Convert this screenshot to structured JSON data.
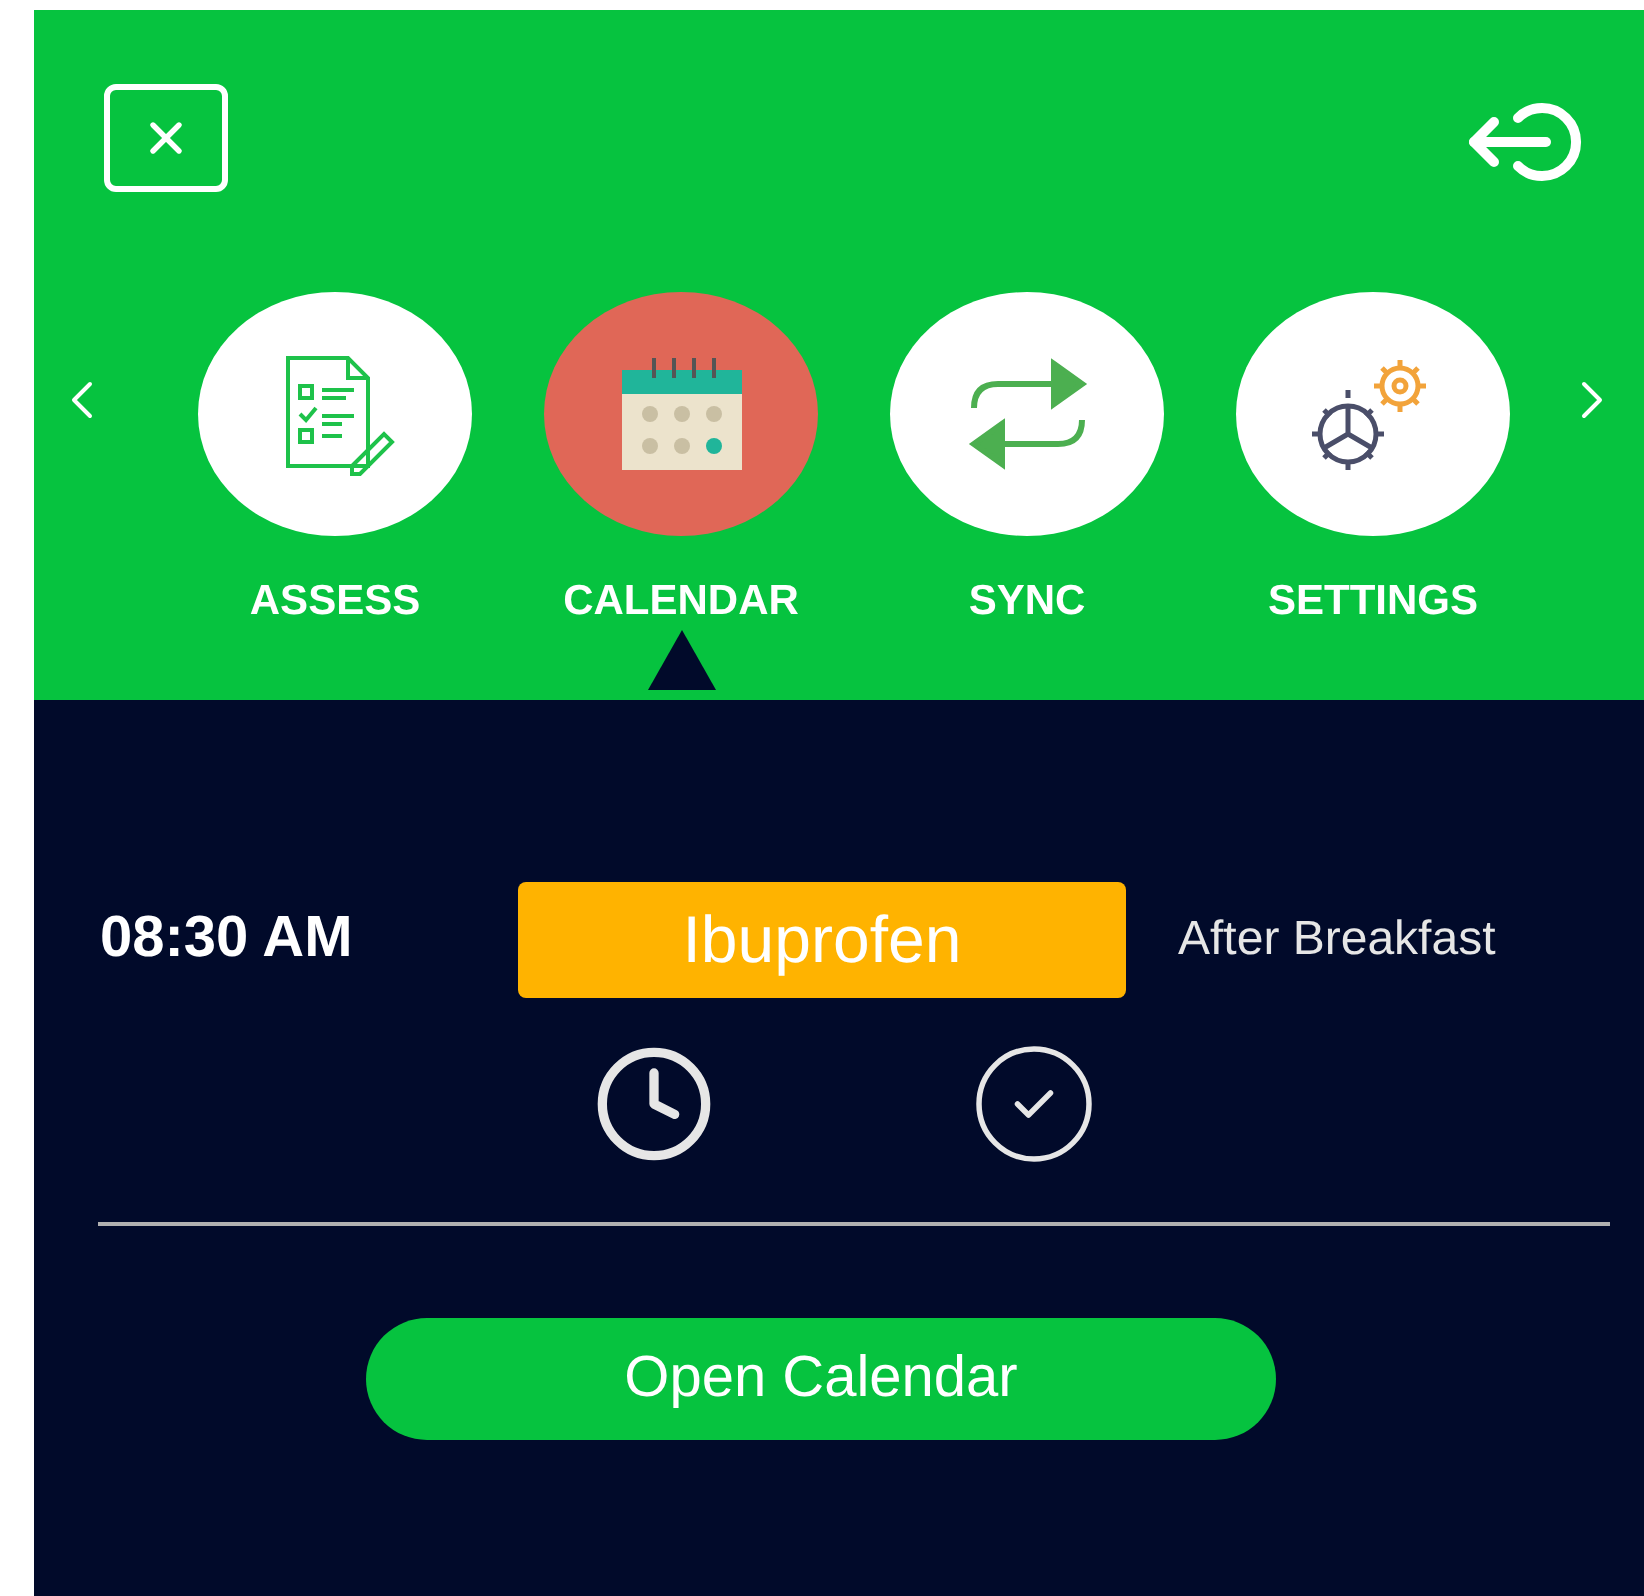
{
  "tabs": [
    {
      "kind": "assess",
      "label": "ASSESS",
      "selected": false
    },
    {
      "kind": "calendar",
      "label": "CALENDAR",
      "selected": true
    },
    {
      "kind": "sync",
      "label": "SYNC",
      "selected": false
    },
    {
      "kind": "settings",
      "label": "SETTINGS",
      "selected": false
    }
  ],
  "reminder": {
    "time": "08:30 AM",
    "medication": "Ibuprofen",
    "note": "After Breakfast"
  },
  "open_button": "Open Calendar"
}
